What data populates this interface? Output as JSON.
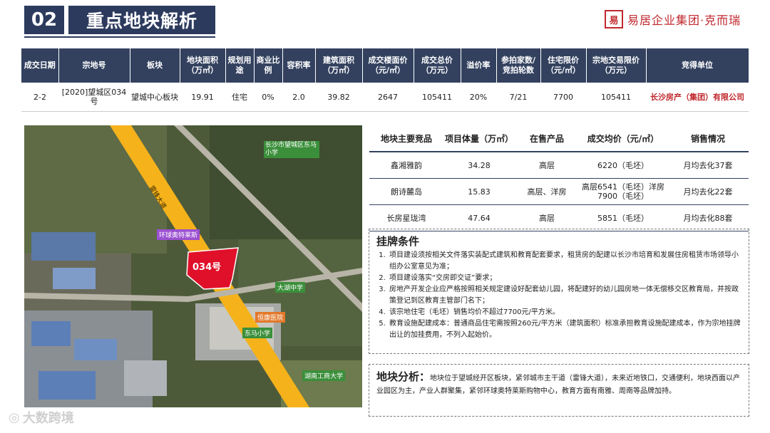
{
  "header": {
    "section_number": "02",
    "title": "重点地块解析",
    "logo_mark": "易",
    "logo_text": "易居企业集团·克而瑞"
  },
  "transaction_table": {
    "headers": [
      "成交日期",
      "宗地号",
      "板块",
      "地块面积（万㎡）",
      "规划用途",
      "商业比例",
      "容积率",
      "建筑面积（万㎡）",
      "成交楼面价（元/㎡）",
      "成交总价（万元）",
      "溢价率",
      "参拍家数/竞拍轮数",
      "住宅限价（元/㎡）",
      "宗地交易限价（万元）",
      "竞得单位"
    ],
    "row": [
      "2-2",
      "[2020]望城区034号",
      "望城中心板块",
      "19.91",
      "住宅",
      "0%",
      "2.0",
      "39.82",
      "2647",
      "105411",
      "20%",
      "7/21",
      "7700",
      "105411",
      "长沙房产（集团）有限公司"
    ]
  },
  "map": {
    "parcel_label": "034号",
    "labels": {
      "school_dongma_upper": "长沙市望城区东马小学",
      "mall": "环球奥特莱斯",
      "dahu_middle": "大湖中学",
      "hospital": "恒康医院",
      "dongma_primary": "东马小学",
      "hunan_univ": "湖南工商大学",
      "road_name": "雷锋大道"
    }
  },
  "project_table": {
    "headers": [
      "地块主要竞品",
      "项目体量（万㎡）",
      "在售产品",
      "成交均价（元/㎡）",
      "销售情况"
    ],
    "rows": [
      {
        "name": "鑫湘雅韵",
        "volume": "34.28",
        "products": "高层",
        "price": "6220（毛坯）",
        "sales": "月均去化37套"
      },
      {
        "name": "朗诗麓岛",
        "volume": "15.83",
        "products": "高层、洋房",
        "price": "高层6541（毛坯）洋房7900（毛坯）",
        "sales": "月均去化22套"
      },
      {
        "name": "长房星珑湾",
        "volume": "47.64",
        "products": "高层",
        "price": "5851（毛坯）",
        "sales": "月均去化88套"
      }
    ]
  },
  "conditions": {
    "title": "挂牌条件",
    "items": [
      "项目建设须按相关文件落实装配式建筑和教育配套要求，租赁房的配建以长沙市培育和发展住房租赁市场领导小组办公室意见为准；",
      "项目建设落实“交房即交证”要求；",
      "房地产开发企业应严格按照相关规定建设好配套幼儿园，将配建好的幼儿园房地一体无偿移交区教育局，并按政策登记到区教育主管部门名下；",
      "该宗地住宅（毛坯）销售均价不超过7700元/平方米。",
      "教育设施配建成本：普通商品住宅需按照260元/平方米（建筑面积）标准承担教育设施配建成本，作为宗地挂牌出让的加挂费用，不列入起始价。"
    ]
  },
  "analysis": {
    "title": "地块分析：",
    "text": "地块位于望城经开区板块，紧邻城市主干道（雷锋大道），未来近地铁口，交通便利，地块西面以产业园区为主，产业人群聚集，紧邻环球奥特莱斯购物中心，教育方面有南雅、周南等品牌加持。"
  },
  "watermark": {
    "text": "大数跨境"
  },
  "colors": {
    "navy": "#33415f",
    "accent_red": "#c0282d",
    "parcel_red": "#e0102a",
    "road_yellow": "#f5b21b"
  }
}
